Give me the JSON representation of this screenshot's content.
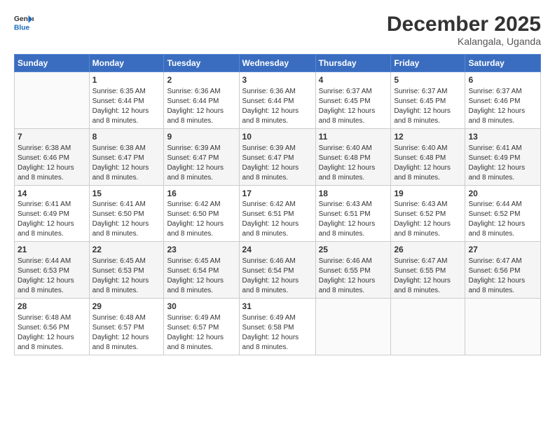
{
  "header": {
    "logo_line1": "General",
    "logo_line2": "Blue",
    "title": "December 2025",
    "subtitle": "Kalangala, Uganda"
  },
  "days_of_week": [
    "Sunday",
    "Monday",
    "Tuesday",
    "Wednesday",
    "Thursday",
    "Friday",
    "Saturday"
  ],
  "weeks": [
    [
      {
        "day": "",
        "sunrise": "",
        "sunset": "",
        "daylight": ""
      },
      {
        "day": "1",
        "sunrise": "Sunrise: 6:35 AM",
        "sunset": "Sunset: 6:44 PM",
        "daylight": "Daylight: 12 hours and 8 minutes."
      },
      {
        "day": "2",
        "sunrise": "Sunrise: 6:36 AM",
        "sunset": "Sunset: 6:44 PM",
        "daylight": "Daylight: 12 hours and 8 minutes."
      },
      {
        "day": "3",
        "sunrise": "Sunrise: 6:36 AM",
        "sunset": "Sunset: 6:44 PM",
        "daylight": "Daylight: 12 hours and 8 minutes."
      },
      {
        "day": "4",
        "sunrise": "Sunrise: 6:37 AM",
        "sunset": "Sunset: 6:45 PM",
        "daylight": "Daylight: 12 hours and 8 minutes."
      },
      {
        "day": "5",
        "sunrise": "Sunrise: 6:37 AM",
        "sunset": "Sunset: 6:45 PM",
        "daylight": "Daylight: 12 hours and 8 minutes."
      },
      {
        "day": "6",
        "sunrise": "Sunrise: 6:37 AM",
        "sunset": "Sunset: 6:46 PM",
        "daylight": "Daylight: 12 hours and 8 minutes."
      }
    ],
    [
      {
        "day": "7",
        "sunrise": "Sunrise: 6:38 AM",
        "sunset": "Sunset: 6:46 PM",
        "daylight": "Daylight: 12 hours and 8 minutes."
      },
      {
        "day": "8",
        "sunrise": "Sunrise: 6:38 AM",
        "sunset": "Sunset: 6:47 PM",
        "daylight": "Daylight: 12 hours and 8 minutes."
      },
      {
        "day": "9",
        "sunrise": "Sunrise: 6:39 AM",
        "sunset": "Sunset: 6:47 PM",
        "daylight": "Daylight: 12 hours and 8 minutes."
      },
      {
        "day": "10",
        "sunrise": "Sunrise: 6:39 AM",
        "sunset": "Sunset: 6:47 PM",
        "daylight": "Daylight: 12 hours and 8 minutes."
      },
      {
        "day": "11",
        "sunrise": "Sunrise: 6:40 AM",
        "sunset": "Sunset: 6:48 PM",
        "daylight": "Daylight: 12 hours and 8 minutes."
      },
      {
        "day": "12",
        "sunrise": "Sunrise: 6:40 AM",
        "sunset": "Sunset: 6:48 PM",
        "daylight": "Daylight: 12 hours and 8 minutes."
      },
      {
        "day": "13",
        "sunrise": "Sunrise: 6:41 AM",
        "sunset": "Sunset: 6:49 PM",
        "daylight": "Daylight: 12 hours and 8 minutes."
      }
    ],
    [
      {
        "day": "14",
        "sunrise": "Sunrise: 6:41 AM",
        "sunset": "Sunset: 6:49 PM",
        "daylight": "Daylight: 12 hours and 8 minutes."
      },
      {
        "day": "15",
        "sunrise": "Sunrise: 6:41 AM",
        "sunset": "Sunset: 6:50 PM",
        "daylight": "Daylight: 12 hours and 8 minutes."
      },
      {
        "day": "16",
        "sunrise": "Sunrise: 6:42 AM",
        "sunset": "Sunset: 6:50 PM",
        "daylight": "Daylight: 12 hours and 8 minutes."
      },
      {
        "day": "17",
        "sunrise": "Sunrise: 6:42 AM",
        "sunset": "Sunset: 6:51 PM",
        "daylight": "Daylight: 12 hours and 8 minutes."
      },
      {
        "day": "18",
        "sunrise": "Sunrise: 6:43 AM",
        "sunset": "Sunset: 6:51 PM",
        "daylight": "Daylight: 12 hours and 8 minutes."
      },
      {
        "day": "19",
        "sunrise": "Sunrise: 6:43 AM",
        "sunset": "Sunset: 6:52 PM",
        "daylight": "Daylight: 12 hours and 8 minutes."
      },
      {
        "day": "20",
        "sunrise": "Sunrise: 6:44 AM",
        "sunset": "Sunset: 6:52 PM",
        "daylight": "Daylight: 12 hours and 8 minutes."
      }
    ],
    [
      {
        "day": "21",
        "sunrise": "Sunrise: 6:44 AM",
        "sunset": "Sunset: 6:53 PM",
        "daylight": "Daylight: 12 hours and 8 minutes."
      },
      {
        "day": "22",
        "sunrise": "Sunrise: 6:45 AM",
        "sunset": "Sunset: 6:53 PM",
        "daylight": "Daylight: 12 hours and 8 minutes."
      },
      {
        "day": "23",
        "sunrise": "Sunrise: 6:45 AM",
        "sunset": "Sunset: 6:54 PM",
        "daylight": "Daylight: 12 hours and 8 minutes."
      },
      {
        "day": "24",
        "sunrise": "Sunrise: 6:46 AM",
        "sunset": "Sunset: 6:54 PM",
        "daylight": "Daylight: 12 hours and 8 minutes."
      },
      {
        "day": "25",
        "sunrise": "Sunrise: 6:46 AM",
        "sunset": "Sunset: 6:55 PM",
        "daylight": "Daylight: 12 hours and 8 minutes."
      },
      {
        "day": "26",
        "sunrise": "Sunrise: 6:47 AM",
        "sunset": "Sunset: 6:55 PM",
        "daylight": "Daylight: 12 hours and 8 minutes."
      },
      {
        "day": "27",
        "sunrise": "Sunrise: 6:47 AM",
        "sunset": "Sunset: 6:56 PM",
        "daylight": "Daylight: 12 hours and 8 minutes."
      }
    ],
    [
      {
        "day": "28",
        "sunrise": "Sunrise: 6:48 AM",
        "sunset": "Sunset: 6:56 PM",
        "daylight": "Daylight: 12 hours and 8 minutes."
      },
      {
        "day": "29",
        "sunrise": "Sunrise: 6:48 AM",
        "sunset": "Sunset: 6:57 PM",
        "daylight": "Daylight: 12 hours and 8 minutes."
      },
      {
        "day": "30",
        "sunrise": "Sunrise: 6:49 AM",
        "sunset": "Sunset: 6:57 PM",
        "daylight": "Daylight: 12 hours and 8 minutes."
      },
      {
        "day": "31",
        "sunrise": "Sunrise: 6:49 AM",
        "sunset": "Sunset: 6:58 PM",
        "daylight": "Daylight: 12 hours and 8 minutes."
      },
      {
        "day": "",
        "sunrise": "",
        "sunset": "",
        "daylight": ""
      },
      {
        "day": "",
        "sunrise": "",
        "sunset": "",
        "daylight": ""
      },
      {
        "day": "",
        "sunrise": "",
        "sunset": "",
        "daylight": ""
      }
    ]
  ]
}
